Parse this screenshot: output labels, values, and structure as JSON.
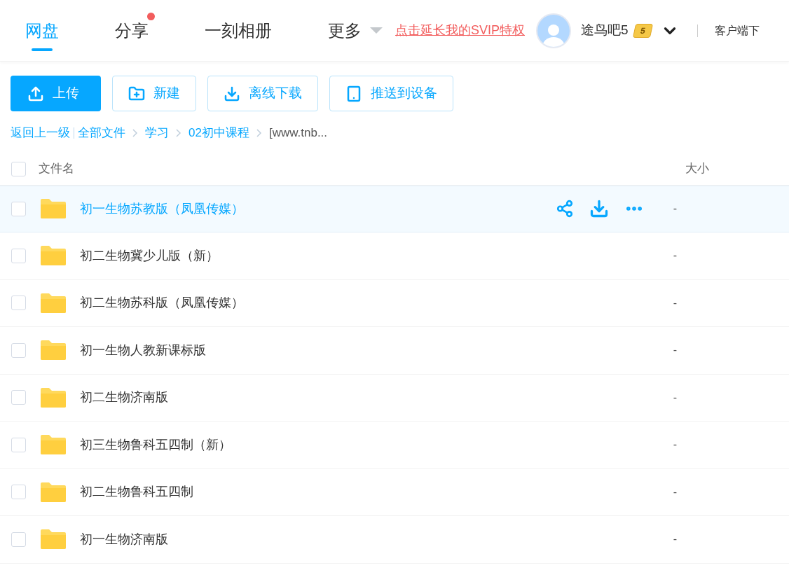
{
  "nav": {
    "tabs": [
      {
        "label": "网盘",
        "selected": true,
        "dot": false,
        "dropdown": false
      },
      {
        "label": "分享",
        "selected": false,
        "dot": true,
        "dropdown": false
      },
      {
        "label": "一刻相册",
        "selected": false,
        "dot": false,
        "dropdown": false
      },
      {
        "label": "更多",
        "selected": false,
        "dot": false,
        "dropdown": true
      }
    ],
    "promo_link": "点击延长我的SVIP特权",
    "user": {
      "name": "途鸟吧5",
      "badge": "5"
    },
    "client_link": "客户端下"
  },
  "toolbar": [
    {
      "kind": "primary",
      "label": "上传"
    },
    {
      "kind": "outline",
      "label": "新建"
    },
    {
      "kind": "outline",
      "label": "离线下载"
    },
    {
      "kind": "outline",
      "label": "推送到设备"
    }
  ],
  "breadcrumb": {
    "back": "返回上一级",
    "items": [
      "全部文件",
      "学习",
      "02初中课程"
    ],
    "current": "[www.tnb..."
  },
  "table": {
    "all_checked": false,
    "columns": [
      "文件名",
      "大小"
    ],
    "rows": [
      {
        "name": "初一生物苏教版（凤凰传媒）",
        "size": "-",
        "hovered": true,
        "checked": false
      },
      {
        "name": "初二生物冀少儿版（新）",
        "size": "-",
        "hovered": false,
        "checked": false
      },
      {
        "name": "初二生物苏科版（凤凰传媒）",
        "size": "-",
        "hovered": false,
        "checked": false
      },
      {
        "name": "初一生物人教新课标版",
        "size": "-",
        "hovered": false,
        "checked": false
      },
      {
        "name": "初二生物济南版",
        "size": "-",
        "hovered": false,
        "checked": false
      },
      {
        "name": "初三生物鲁科五四制（新）",
        "size": "-",
        "hovered": false,
        "checked": false
      },
      {
        "name": "初二生物鲁科五四制",
        "size": "-",
        "hovered": false,
        "checked": false
      },
      {
        "name": "初一生物济南版",
        "size": "-",
        "hovered": false,
        "checked": false
      }
    ]
  }
}
